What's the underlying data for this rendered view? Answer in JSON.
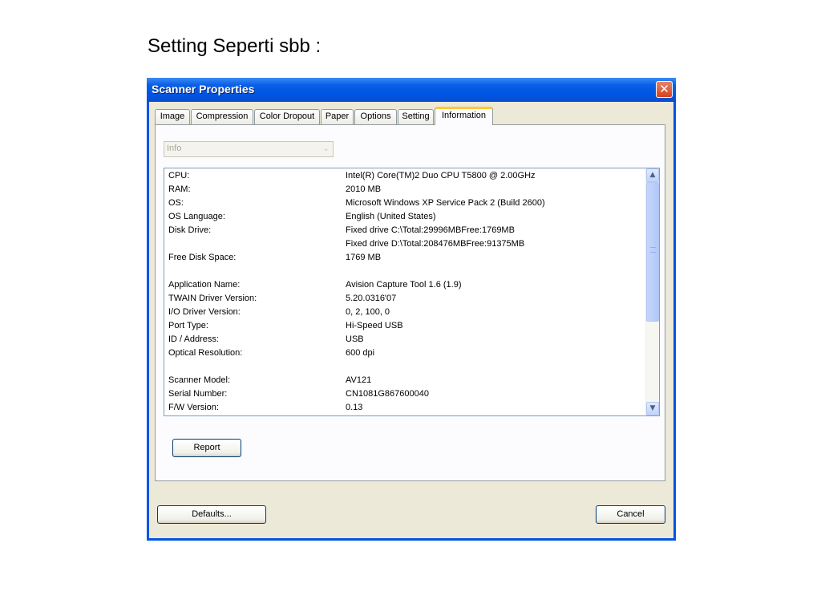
{
  "slide": {
    "title": "Setting Seperti sbb :"
  },
  "window": {
    "title": "Scanner Properties",
    "close_glyph": "✕"
  },
  "tabs": [
    {
      "label": "Image",
      "active": false
    },
    {
      "label": "Compression",
      "active": false
    },
    {
      "label": "Color Dropout",
      "active": false
    },
    {
      "label": "Paper",
      "active": false
    },
    {
      "label": "Options",
      "active": false
    },
    {
      "label": "Setting",
      "active": false
    },
    {
      "label": "Information",
      "active": true
    }
  ],
  "combo": {
    "value": "Info",
    "arrow_glyph": "⌄"
  },
  "info": [
    {
      "label": "CPU:",
      "value": "Intel(R) Core(TM)2 Duo CPU     T5800  @ 2.00GHz"
    },
    {
      "label": "RAM:",
      "value": "2010 MB"
    },
    {
      "label": "OS:",
      "value": "Microsoft Windows XP Service Pack 2 (Build 2600)"
    },
    {
      "label": "OS Language:",
      "value": "English (United States)"
    },
    {
      "label": "Disk Drive:",
      "value": "Fixed drive C:\\Total:29996MBFree:1769MB"
    },
    {
      "label": "",
      "value": "Fixed drive D:\\Total:208476MBFree:91375MB"
    },
    {
      "label": "Free Disk Space:",
      "value": "1769 MB"
    },
    {
      "label": "Application Name:",
      "value": " Avision Capture Tool 1.6 (1.9)"
    },
    {
      "label": "TWAIN Driver Version:",
      "value": "5.20.0316'07"
    },
    {
      "label": "I/O Driver Version:",
      "value": "0, 2, 100, 0"
    },
    {
      "label": "Port Type:",
      "value": "Hi-Speed USB"
    },
    {
      "label": "ID / Address:",
      "value": "USB"
    },
    {
      "label": "Optical Resolution:",
      "value": "600 dpi"
    },
    {
      "label": "Scanner Model:",
      "value": "AV121"
    },
    {
      "label": "Serial Number:",
      "value": "CN1081G867600040"
    },
    {
      "label": "F/W Version:",
      "value": "0.13"
    }
  ],
  "scrollbar": {
    "up_glyph": "▲",
    "down_glyph": "▼"
  },
  "buttons": {
    "report": "Report",
    "defaults": "Defaults...",
    "cancel": "Cancel"
  }
}
